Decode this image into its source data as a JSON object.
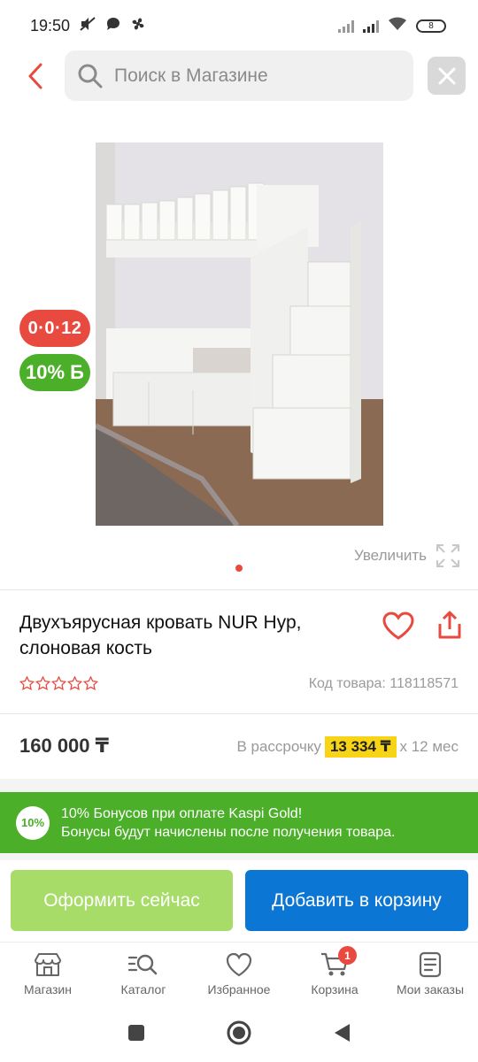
{
  "status": {
    "time": "19:50",
    "battery": "8"
  },
  "search": {
    "placeholder": "Поиск в Магазине"
  },
  "badges": {
    "installment_tag": "0·0·12",
    "bonus_tag": "10% Б"
  },
  "gallery": {
    "zoom_label": "Увеличить"
  },
  "product": {
    "title": "Двухъярусная кровать NUR Нур, слоновая кость",
    "code": "Код товара: 118118571",
    "price": "160 000 ₸",
    "installment_prefix": "В рассрочку",
    "installment_monthly": "13 334 ₸",
    "installment_suffix": "x 12 мес",
    "rating": 0
  },
  "bonus": {
    "badge": "10%",
    "line1": "10% Бонусов при оплате Kaspi Gold!",
    "line2": "Бонусы будут начислены после получения товара."
  },
  "actions": {
    "buy_now": "Оформить сейчас",
    "add_to_cart": "Добавить в корзину"
  },
  "tabs": [
    {
      "label": "Магазин",
      "icon": "shop-icon"
    },
    {
      "label": "Каталог",
      "icon": "catalog-search-icon"
    },
    {
      "label": "Избранное",
      "icon": "heart-icon"
    },
    {
      "label": "Корзина",
      "icon": "cart-icon",
      "count": "1"
    },
    {
      "label": "Мои заказы",
      "icon": "orders-icon"
    }
  ],
  "colors": {
    "accent_red": "#e84a3f",
    "kaspi_green": "#4caf29",
    "primary_blue": "#0c76d4",
    "light_green": "#a7dc69",
    "installment_yellow": "#f7d416"
  }
}
